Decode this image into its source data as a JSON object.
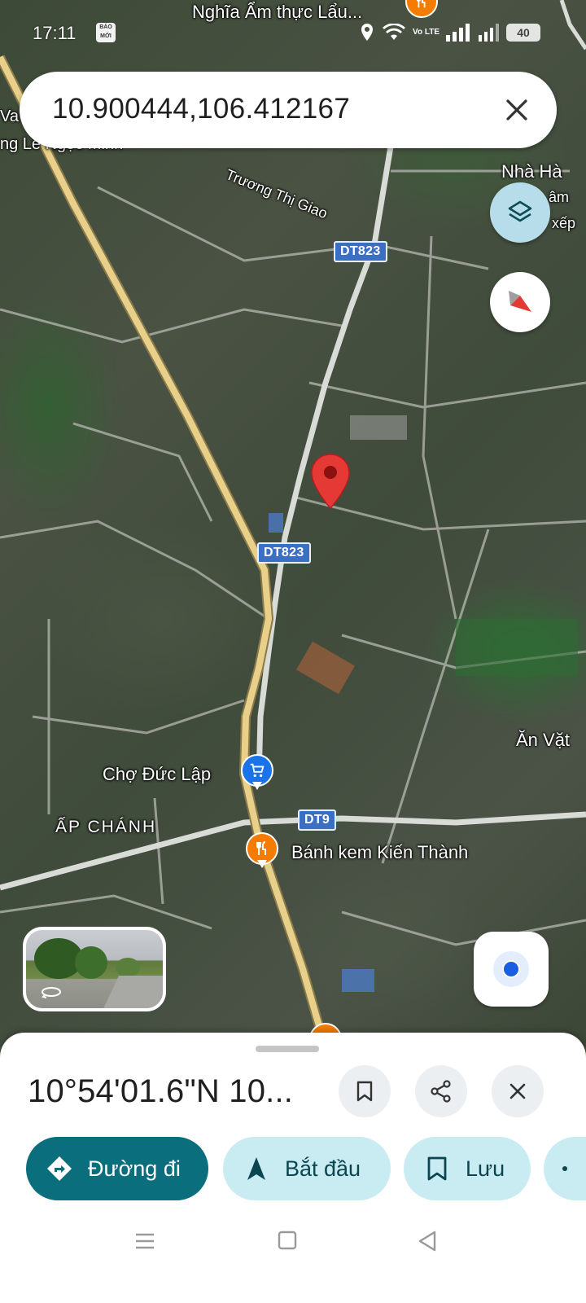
{
  "status_bar": {
    "time": "17:11",
    "badge": "BÁO MỚI",
    "network": "Vo LTE",
    "battery": "40"
  },
  "search": {
    "query": "10.900444,106.412167"
  },
  "map": {
    "labels": {
      "restaurant_top": "Nghĩa Ẩm thực Lẩu...",
      "left_top_a": "Va",
      "left_top_b": "ng Lê Ngọc Minh",
      "truong_thi_giao": "Trương Thị Giao",
      "nha_hang": "Nhà Hà",
      "nha_hang_b": "âm",
      "nha_hang_c": "xếp",
      "an_vat": "Ăn Vặt",
      "cho_duc_lap": "Chợ Đức Lập",
      "ap_chanh": "ẤP CHÁNH",
      "banh_kem": "Bánh kem Kiến Thành"
    },
    "shields": {
      "dt823_top": "DT823",
      "dt823_mid": "DT823",
      "dt9": "DT9"
    },
    "colors": {
      "pin_red": "#e53935",
      "poi_blue": "#1a73e8",
      "poi_orange": "#f57c00",
      "road_yellow": "#e8d08a"
    }
  },
  "sheet": {
    "title": "10°54'01.6\"N 10...",
    "actions": {
      "directions": "Đường đi",
      "start": "Bắt đầu",
      "save": "Lưu"
    },
    "colors": {
      "primary": "#0b6e7d",
      "secondary": "#c9ecf3"
    }
  }
}
